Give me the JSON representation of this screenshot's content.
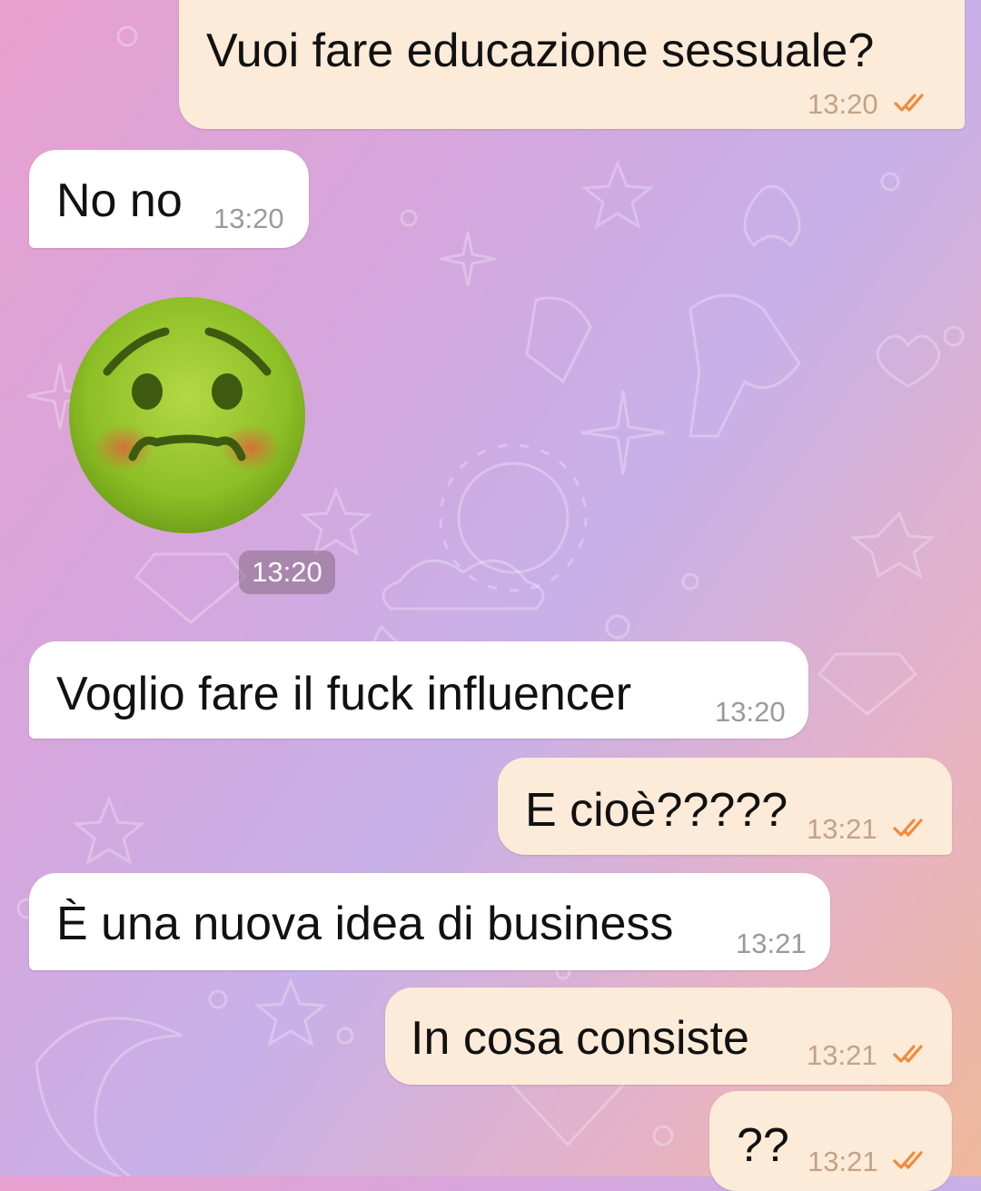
{
  "chat": {
    "messages": [
      {
        "direction": "outgoing",
        "text": "Vuoi fare educazione sessuale?",
        "time": "13:20",
        "status": "read"
      },
      {
        "direction": "incoming",
        "text": "No no",
        "time": "13:20"
      },
      {
        "direction": "incoming",
        "type": "sticker",
        "sticker": "nauseated-face-emoji",
        "time": "13:20"
      },
      {
        "direction": "incoming",
        "text": "Voglio fare il fuck influencer",
        "time": "13:20"
      },
      {
        "direction": "outgoing",
        "text": "E cioè?????",
        "time": "13:21",
        "status": "read"
      },
      {
        "direction": "incoming",
        "text": "È una nuova idea di business",
        "time": "13:21"
      },
      {
        "direction": "outgoing",
        "text": "In cosa consiste",
        "time": "13:21",
        "status": "read"
      },
      {
        "direction": "outgoing",
        "text": "??",
        "time": "13:21",
        "status": "read"
      }
    ]
  },
  "colors": {
    "outgoing_bubble": "#fcebd8",
    "incoming_bubble": "#ffffff",
    "read_ticks": "#f08a3c",
    "sticker_green": "#8fbe2a"
  }
}
